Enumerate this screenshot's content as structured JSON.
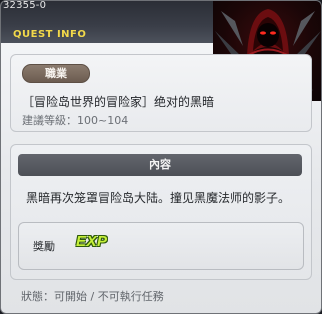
{
  "header": {
    "quest_id": "32355-0",
    "section_label": "QUEST INFO"
  },
  "portrait": {
    "icon": "hooded-black-mage-portrait",
    "accent": "#c01818"
  },
  "job": {
    "badge_label": "職業",
    "quest_title": "［冒险岛世界的冒险家］绝对的黑暗",
    "level_text": "建議等級：100~104"
  },
  "content": {
    "header_label": "內容",
    "description": "黑暗再次笼罩冒险岛大陆。撞见黑魔法师的影子。",
    "reward_label": "獎勵",
    "reward_icon_text": "EXP"
  },
  "status": {
    "text": "狀態：可開始 / 不可執行任務"
  },
  "colors": {
    "header_bg": "#3a3e48",
    "quest_info_yellow": "#f2d94a",
    "badge_brown": "#7a6a5e",
    "exp_green": "#c6f03a"
  }
}
